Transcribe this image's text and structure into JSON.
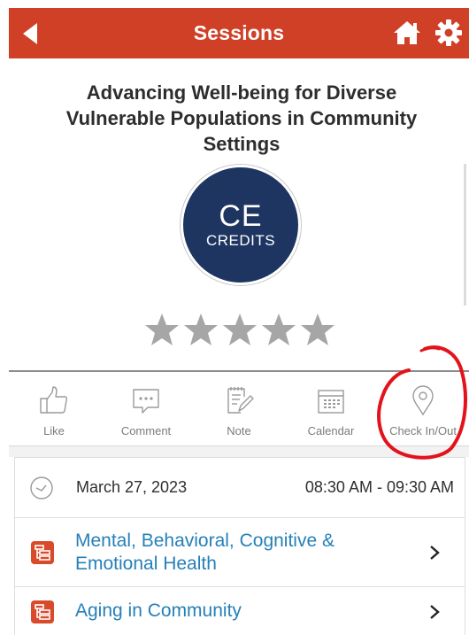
{
  "header": {
    "title": "Sessions",
    "color": "#cf4027",
    "back_icon": "back-arrow-icon",
    "home_icon": "home-icon",
    "settings_icon": "gear-icon"
  },
  "session": {
    "title": "Advancing Well-being for Diverse Vulnerable Populations in Community Settings",
    "logo": {
      "line1": "CE",
      "line2": "CREDITS",
      "color": "#1d3560"
    },
    "rating": {
      "value": 0,
      "max": 5
    }
  },
  "actions": [
    {
      "label": "Like",
      "icon": "thumbs-up-icon"
    },
    {
      "label": "Comment",
      "icon": "comment-icon"
    },
    {
      "label": "Note",
      "icon": "note-icon"
    },
    {
      "label": "Calendar",
      "icon": "calendar-icon"
    },
    {
      "label": "Check In/Out",
      "icon": "location-pin-icon"
    }
  ],
  "details": {
    "date": "March 27, 2023",
    "time": "08:30 AM - 09:30 AM",
    "tracks": [
      {
        "label": "Mental, Behavioral, Cognitive & Emotional Health",
        "color": "#d94a2b"
      },
      {
        "label": "Aging in Community",
        "color": "#d94a2b"
      }
    ]
  }
}
